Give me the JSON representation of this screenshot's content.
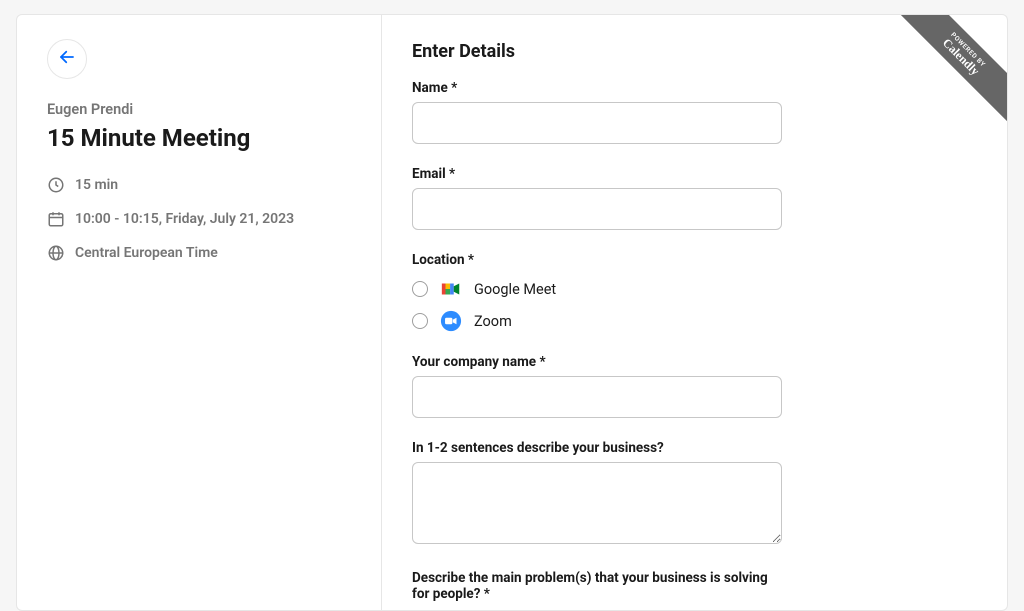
{
  "left": {
    "host_name": "Eugen Prendi",
    "meeting_title": "15 Minute Meeting",
    "duration_text": "15 min",
    "datetime_text": "10:00 - 10:15, Friday, July 21, 2023",
    "timezone_text": "Central European Time"
  },
  "form": {
    "title": "Enter Details",
    "required_star": "*",
    "name_label": "Name",
    "email_label": "Email",
    "location_label": "Location",
    "location_options": {
      "google_meet": "Google Meet",
      "zoom": "Zoom"
    },
    "company_label": "Your company name",
    "describe_label": "In 1-2 sentences describe your business?",
    "problem_label": "Describe the main problem(s) that your business is solving for people?"
  },
  "ribbon": {
    "small": "POWERED BY",
    "big": "Calendly"
  }
}
